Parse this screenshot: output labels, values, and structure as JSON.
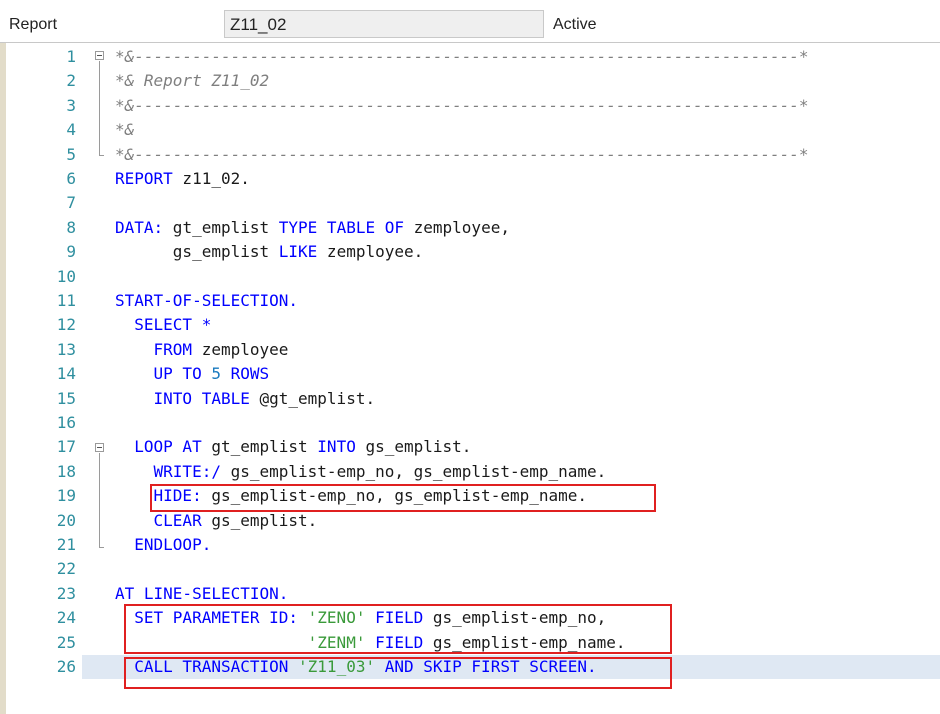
{
  "header": {
    "label": "Report",
    "program_name": "Z11_02",
    "status": "Active"
  },
  "editor": {
    "line_numbers": [
      "1",
      "2",
      "3",
      "4",
      "5",
      "6",
      "7",
      "8",
      "9",
      "10",
      "11",
      "12",
      "13",
      "14",
      "15",
      "16",
      "17",
      "18",
      "19",
      "20",
      "21",
      "22",
      "23",
      "24",
      "25",
      "26"
    ],
    "current_line": "26",
    "lines": [
      [
        {
          "t": "*&---------------------------------------------------------------------*",
          "c": "cm"
        }
      ],
      [
        {
          "t": "*& Report Z11_02",
          "c": "cm"
        }
      ],
      [
        {
          "t": "*&---------------------------------------------------------------------*",
          "c": "cm"
        }
      ],
      [
        {
          "t": "*&",
          "c": "cm"
        }
      ],
      [
        {
          "t": "*&---------------------------------------------------------------------*",
          "c": "cm"
        }
      ],
      [
        {
          "t": "REPORT",
          "c": "kw"
        },
        {
          "t": " z11_02.",
          "c": "ob"
        }
      ],
      [],
      [
        {
          "t": "DATA:",
          "c": "kw"
        },
        {
          "t": " gt_emplist ",
          "c": "ob"
        },
        {
          "t": "TYPE TABLE OF",
          "c": "kw"
        },
        {
          "t": " zemployee,",
          "c": "ob"
        }
      ],
      [
        {
          "t": "      gs_emplist ",
          "c": "ob"
        },
        {
          "t": "LIKE",
          "c": "kw"
        },
        {
          "t": " zemployee.",
          "c": "ob"
        }
      ],
      [],
      [
        {
          "t": "START-OF-SELECTION.",
          "c": "kw"
        }
      ],
      [
        {
          "t": "  SELECT *",
          "c": "kw"
        }
      ],
      [
        {
          "t": "    FROM",
          "c": "kw"
        },
        {
          "t": " zemployee",
          "c": "ob"
        }
      ],
      [
        {
          "t": "    UP TO ",
          "c": "kw"
        },
        {
          "t": "5",
          "c": "nm"
        },
        {
          "t": " ROWS",
          "c": "kw"
        }
      ],
      [
        {
          "t": "    INTO TABLE",
          "c": "kw"
        },
        {
          "t": " @gt_emplist.",
          "c": "ob"
        }
      ],
      [],
      [
        {
          "t": "  LOOP AT",
          "c": "kw"
        },
        {
          "t": " gt_emplist ",
          "c": "ob"
        },
        {
          "t": "INTO",
          "c": "kw"
        },
        {
          "t": " gs_emplist.",
          "c": "ob"
        }
      ],
      [
        {
          "t": "    WRITE:/",
          "c": "kw"
        },
        {
          "t": " gs_emplist-emp_no, gs_emplist-emp_name.",
          "c": "ob"
        }
      ],
      [
        {
          "t": "    HIDE:",
          "c": "kw"
        },
        {
          "t": " gs_emplist-emp_no, gs_emplist-emp_name.",
          "c": "ob"
        }
      ],
      [
        {
          "t": "    CLEAR",
          "c": "kw"
        },
        {
          "t": " gs_emplist.",
          "c": "ob"
        }
      ],
      [
        {
          "t": "  ENDLOOP.",
          "c": "kw"
        }
      ],
      [],
      [
        {
          "t": "AT LINE-SELECTION.",
          "c": "kw"
        }
      ],
      [
        {
          "t": "  SET PARAMETER ID: ",
          "c": "kw"
        },
        {
          "t": "'ZENO'",
          "c": "st"
        },
        {
          "t": " FIELD",
          "c": "kw"
        },
        {
          "t": " gs_emplist-emp_no,",
          "c": "ob"
        }
      ],
      [
        {
          "t": "                    ",
          "c": "ob"
        },
        {
          "t": "'ZENM'",
          "c": "st"
        },
        {
          "t": " FIELD",
          "c": "kw"
        },
        {
          "t": " gs_emplist-emp_name.",
          "c": "ob"
        }
      ],
      [
        {
          "t": "  CALL TRANSACTION ",
          "c": "kw"
        },
        {
          "t": "'Z11_03'",
          "c": "st"
        },
        {
          "t": " AND SKIP FIRST SCREEN.",
          "c": "kw"
        }
      ]
    ]
  },
  "colors": {
    "keyword": "#0000ff",
    "comment": "#7f7f7f",
    "string": "#3a9a3a",
    "number": "#1a7abf",
    "line_number": "#2f8f9f",
    "highlight_box": "#e02020",
    "current_line_bg": "#dfe8f3"
  },
  "fold_icons": [
    "collapse-icon",
    "collapse-icon"
  ]
}
